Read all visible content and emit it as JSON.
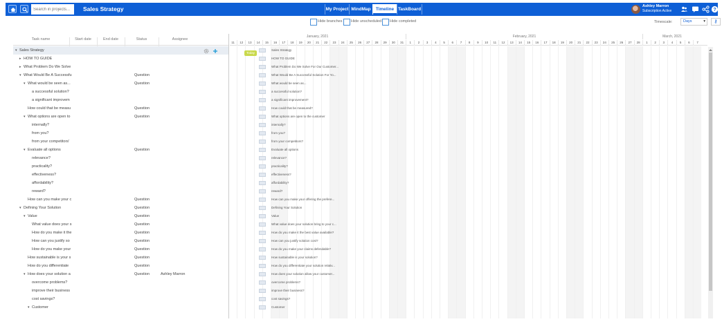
{
  "header": {
    "search_placeholder": "Search in projects...",
    "title": "Sales Strategy",
    "tabs": [
      {
        "label": "My Project"
      },
      {
        "label": "MindMap"
      },
      {
        "label": "Timeline"
      },
      {
        "label": "TaskBoard"
      }
    ],
    "active_tab": "Timeline",
    "user_name": "Ashley Marron",
    "user_subtitle": "Subscription Active",
    "brand_color": "#0e5fd6"
  },
  "toolbar": {
    "hide_branches": "Hide branches",
    "hide_unscheduled": "Hide unscheduled",
    "hide_completed": "Hide completed",
    "timescale_label": "Timescale:",
    "timescale_value": "Days"
  },
  "grid": {
    "columns": [
      "Task name",
      "Start date",
      "End date",
      "Status",
      "Assignee"
    ],
    "rows": [
      {
        "name": "Sales Strategy",
        "status": "",
        "assignee": ""
      },
      {
        "name": "HOW TO GUIDE",
        "status": "",
        "assignee": ""
      },
      {
        "name": "What Problem Do We Solve",
        "status": "",
        "assignee": ""
      },
      {
        "name": "What Would Be A Successfu",
        "status": "Question",
        "assignee": ""
      },
      {
        "name": "What would be seen as...",
        "status": "Question",
        "assignee": ""
      },
      {
        "name": "a successful solution?",
        "status": "",
        "assignee": ""
      },
      {
        "name": "a significant improvem",
        "status": "",
        "assignee": ""
      },
      {
        "name": "How could that be measu",
        "status": "Question",
        "assignee": ""
      },
      {
        "name": "What options are open to",
        "status": "Question",
        "assignee": ""
      },
      {
        "name": "internally?",
        "status": "",
        "assignee": ""
      },
      {
        "name": "from you?",
        "status": "",
        "assignee": ""
      },
      {
        "name": "from your competitors'",
        "status": "",
        "assignee": ""
      },
      {
        "name": "Evaluate all options",
        "status": "Question",
        "assignee": ""
      },
      {
        "name": "relevance?",
        "status": "",
        "assignee": ""
      },
      {
        "name": "practicality?",
        "status": "",
        "assignee": ""
      },
      {
        "name": "effectiveness?",
        "status": "",
        "assignee": ""
      },
      {
        "name": "affordability?",
        "status": "",
        "assignee": ""
      },
      {
        "name": "reward?",
        "status": "",
        "assignee": ""
      },
      {
        "name": "How can you make your c",
        "status": "Question",
        "assignee": ""
      },
      {
        "name": "Defining Your Solution",
        "status": "Question",
        "assignee": ""
      },
      {
        "name": "Value",
        "status": "Question",
        "assignee": ""
      },
      {
        "name": "What value does your s",
        "status": "Question",
        "assignee": ""
      },
      {
        "name": "How do you make it the",
        "status": "Question",
        "assignee": ""
      },
      {
        "name": "How can you justify so",
        "status": "Question",
        "assignee": ""
      },
      {
        "name": "How do you make your",
        "status": "Question",
        "assignee": ""
      },
      {
        "name": "How sustainable is your s",
        "status": "Question",
        "assignee": ""
      },
      {
        "name": "How do you differentiate",
        "status": "Question",
        "assignee": ""
      },
      {
        "name": "How does your solution a",
        "status": "Question",
        "assignee": "Ashley Marron"
      },
      {
        "name": "overcome problems?",
        "status": "",
        "assignee": ""
      },
      {
        "name": "improve their business",
        "status": "",
        "assignee": ""
      },
      {
        "name": "cost savings?",
        "status": "",
        "assignee": ""
      },
      {
        "name": "Customer",
        "status": "",
        "assignee": ""
      }
    ]
  },
  "timeline": {
    "months": [
      "January, 2021",
      "February, 2021",
      "March, 2021"
    ],
    "jan_days": [
      "11",
      "12",
      "13",
      "14",
      "15",
      "16",
      "17",
      "18",
      "19",
      "20",
      "21",
      "22",
      "23",
      "24",
      "25",
      "26",
      "27",
      "28",
      "29",
      "30",
      "31"
    ],
    "feb_days": [
      "1",
      "2",
      "3",
      "4",
      "5",
      "6",
      "7",
      "8",
      "9",
      "10",
      "11",
      "12",
      "13",
      "14",
      "15",
      "16",
      "17",
      "18",
      "19",
      "20",
      "21",
      "22",
      "23",
      "24",
      "25",
      "26",
      "27",
      "28"
    ],
    "mar_days": [
      "1",
      "2",
      "3",
      "4",
      "5",
      "6",
      "7"
    ],
    "today_label": "Today",
    "task_labels": [
      "Sales Strategy",
      "HOW TO GUIDE",
      "What Problem Do We Solve For Our Customer...",
      "What Would Be A Successful Solution For Yo...",
      "What would be seen as...",
      "a successful solution?",
      "a significant improvement?",
      "How could that be measured?",
      "What options are open to the customer",
      "internally?",
      "from you?",
      "from your competitors?",
      "Evaluate all options",
      "relevance?",
      "practicality?",
      "effectiveness?",
      "affordability?",
      "reward?",
      "How can you make your offering the prefere...",
      "Defining Your Solution",
      "Value",
      "What value does your solution bring to your c...",
      "How do you make it the best value available?",
      "How can you justify solution cost?",
      "How do you make your claims defendable?",
      "How sustainable is your solution?",
      "How do you differentiate your solution relativ...",
      "How does your solution allow your customer...",
      "overcome problems?",
      "improve their business?",
      "cost savings?",
      "Customer"
    ]
  }
}
